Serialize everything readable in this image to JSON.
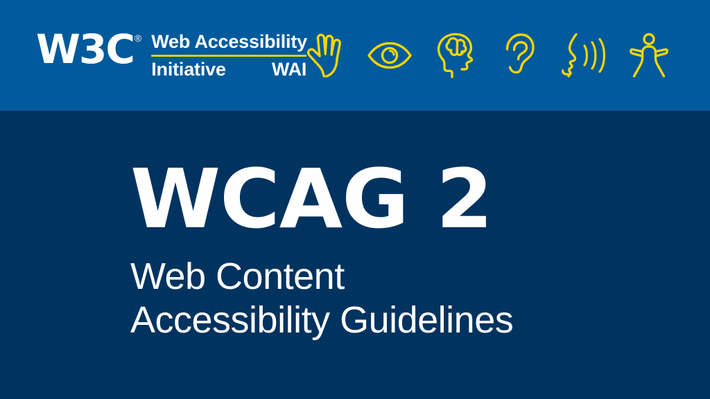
{
  "banner": {
    "background_color": "#005a9c",
    "logo": {
      "w3c_mark": "W3C",
      "registered_symbol": "®",
      "line1": "Web Accessibility",
      "line2_left": "Initiative",
      "line2_right": "WAI",
      "rule_color": "#d8d117"
    },
    "icons": [
      {
        "name": "hand-icon",
        "label": "Hand"
      },
      {
        "name": "eye-icon",
        "label": "Eye"
      },
      {
        "name": "brain-head-icon",
        "label": "Head with brain"
      },
      {
        "name": "ear-icon",
        "label": "Ear"
      },
      {
        "name": "speech-icon",
        "label": "Speaking face with sound waves"
      },
      {
        "name": "accessibility-person-icon",
        "label": "Person with outstretched arms"
      }
    ],
    "icon_color": "#f2d602"
  },
  "main": {
    "background_color": "#00335f",
    "title": "WCAG 2",
    "subtitle_line1": "Web Content",
    "subtitle_line2": "Accessibility Guidelines",
    "text_color": "#ffffff"
  }
}
